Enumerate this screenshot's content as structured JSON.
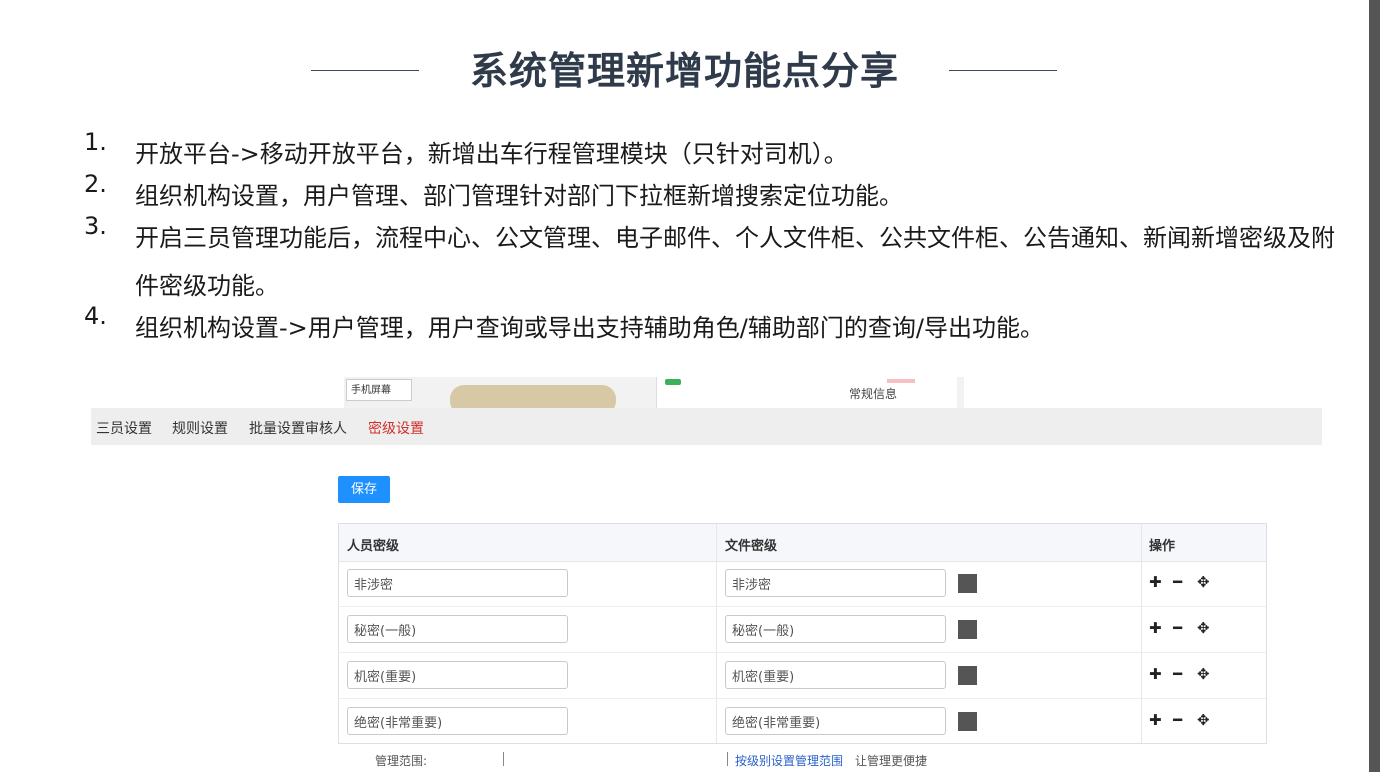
{
  "slide": {
    "title": "系统管理新增功能点分享",
    "points": [
      {
        "num": "1.",
        "text": "开放平台->移动开放平台，新增出车行程管理模块（只针对司机）。"
      },
      {
        "num": "2.",
        "text": "组织机构设置，用户管理、部门管理针对部门下拉框新增搜索定位功能。"
      },
      {
        "num": "3.",
        "text": "开启三员管理功能后，流程中心、公文管理、电子邮件、个人文件柜、公共文件柜、公告通知、新闻新增密级及附件密级功能。"
      },
      {
        "num": "4.",
        "text": "组织机构设置->用户管理，用户查询或导出支持辅助角色/辅助部门的查询/导出功能。"
      }
    ]
  },
  "background_shot": {
    "phone_tab": "手机屏幕",
    "panel_text": "常规信息"
  },
  "screenshot": {
    "tabs": [
      "三员设置",
      "规则设置",
      "批量设置审核人",
      "密级设置"
    ],
    "active_tab": "密级设置",
    "save_label": "保存",
    "columns": [
      "人员密级",
      "文件密级",
      "操作"
    ],
    "rows": [
      {
        "person": "非涉密",
        "file": "非涉密",
        "color": "#555555"
      },
      {
        "person": "秘密(一般)",
        "file": "秘密(一般)",
        "color": "#555555"
      },
      {
        "person": "机密(重要)",
        "file": "机密(重要)",
        "color": "#555555"
      },
      {
        "person": "绝密(非常重要)",
        "file": "绝密(非常重要)",
        "color": "#555555"
      }
    ],
    "ops_icons": [
      "plus-icon",
      "minus-icon",
      "move-icon"
    ],
    "ops_glyphs": [
      "✚",
      "━",
      "✥"
    ]
  },
  "bottom_peek": {
    "left_text": "管理范围:",
    "link_text": "按级别设置管理范围",
    "right_text": "让管理更便捷"
  },
  "colors": {
    "title": "#2f3b4a",
    "active_tab": "#d0302a",
    "primary_button": "#1e90ff"
  }
}
